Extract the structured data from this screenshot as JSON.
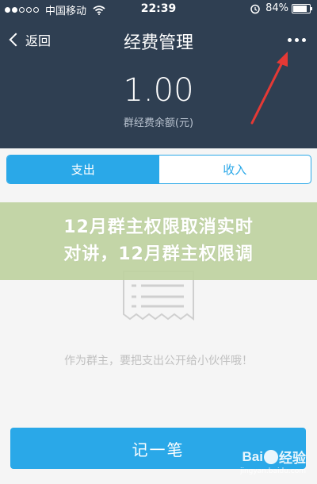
{
  "status_bar": {
    "carrier": "中国移动",
    "time": "22:39",
    "battery_percent": "84%",
    "battery_level": 0.84,
    "icons": [
      "signal-icon",
      "wifi-icon",
      "alarm-icon",
      "battery-icon"
    ]
  },
  "nav": {
    "back_label": "返回",
    "title": "经费管理",
    "more_icon": "more-dots-icon"
  },
  "balance": {
    "value": "1.00",
    "label": "群经费余额(元)"
  },
  "tabs": [
    {
      "label": "支出",
      "active": true
    },
    {
      "label": "收入",
      "active": false
    }
  ],
  "overlay": {
    "line1": "12月群主权限取消实时",
    "line2": "对讲，12月群主权限调"
  },
  "empty_state": {
    "icon": "receipt-icon",
    "hint": "作为群主，要把支出公开给小伙伴哦！"
  },
  "record_button": {
    "label": "记一笔"
  },
  "annotation": {
    "color": "#e53935",
    "icon": "red-arrow"
  },
  "watermark": {
    "brand_left": "Bai",
    "brand_right": "经验",
    "sub": "jingyan.baidu.com"
  },
  "colors": {
    "header": "#2f3f52",
    "accent": "#2aa8e8"
  }
}
